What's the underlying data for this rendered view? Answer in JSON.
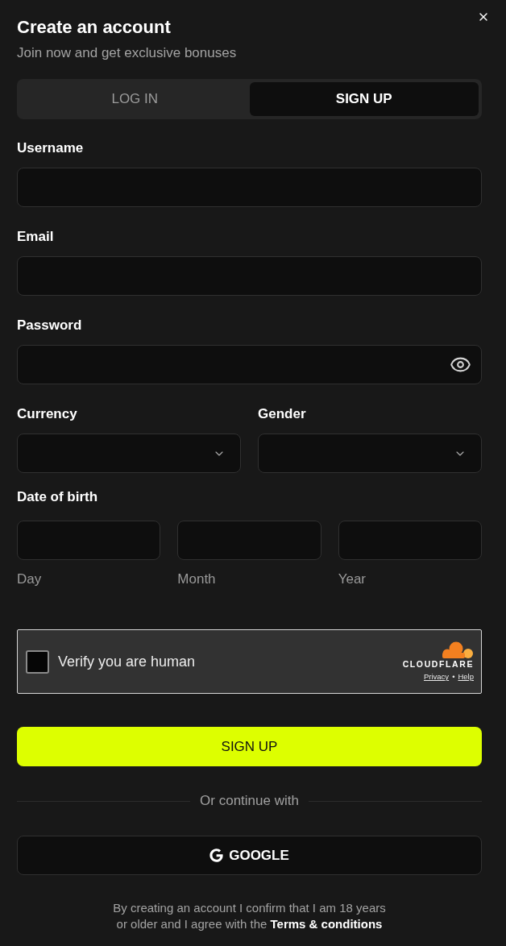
{
  "dialog": {
    "title": "Create an account",
    "subtitle": "Join now and get exclusive bonuses"
  },
  "tabs": [
    {
      "label": "LOG IN",
      "selected": false
    },
    {
      "label": "SIGN UP",
      "selected": true
    }
  ],
  "fields": [
    {
      "label": "Username",
      "kind": "text"
    },
    {
      "label": "Email",
      "kind": "text"
    },
    {
      "label": "Password",
      "kind": "password"
    }
  ],
  "selects": [
    {
      "label": "Currency"
    },
    {
      "label": "Gender"
    }
  ],
  "date_of_birth": {
    "label": "Date of birth",
    "parts": [
      {
        "caption": "Day"
      },
      {
        "caption": "Month"
      },
      {
        "caption": "Year"
      }
    ]
  },
  "captcha": {
    "label": "Verify you are human",
    "checked": false,
    "brand": "CLOUDFLARE",
    "links": [
      "Privacy",
      "Help"
    ],
    "separator": "•"
  },
  "submit": {
    "label": "SIGN UP"
  },
  "divider": {
    "label": "Or continue with"
  },
  "social_buttons": [
    {
      "label": "GOOGLE",
      "kind": "google"
    }
  ],
  "footer": {
    "text": "By creating an account I confirm that I am 18 years or older and I agree with the",
    "link": "Terms & conditions"
  }
}
